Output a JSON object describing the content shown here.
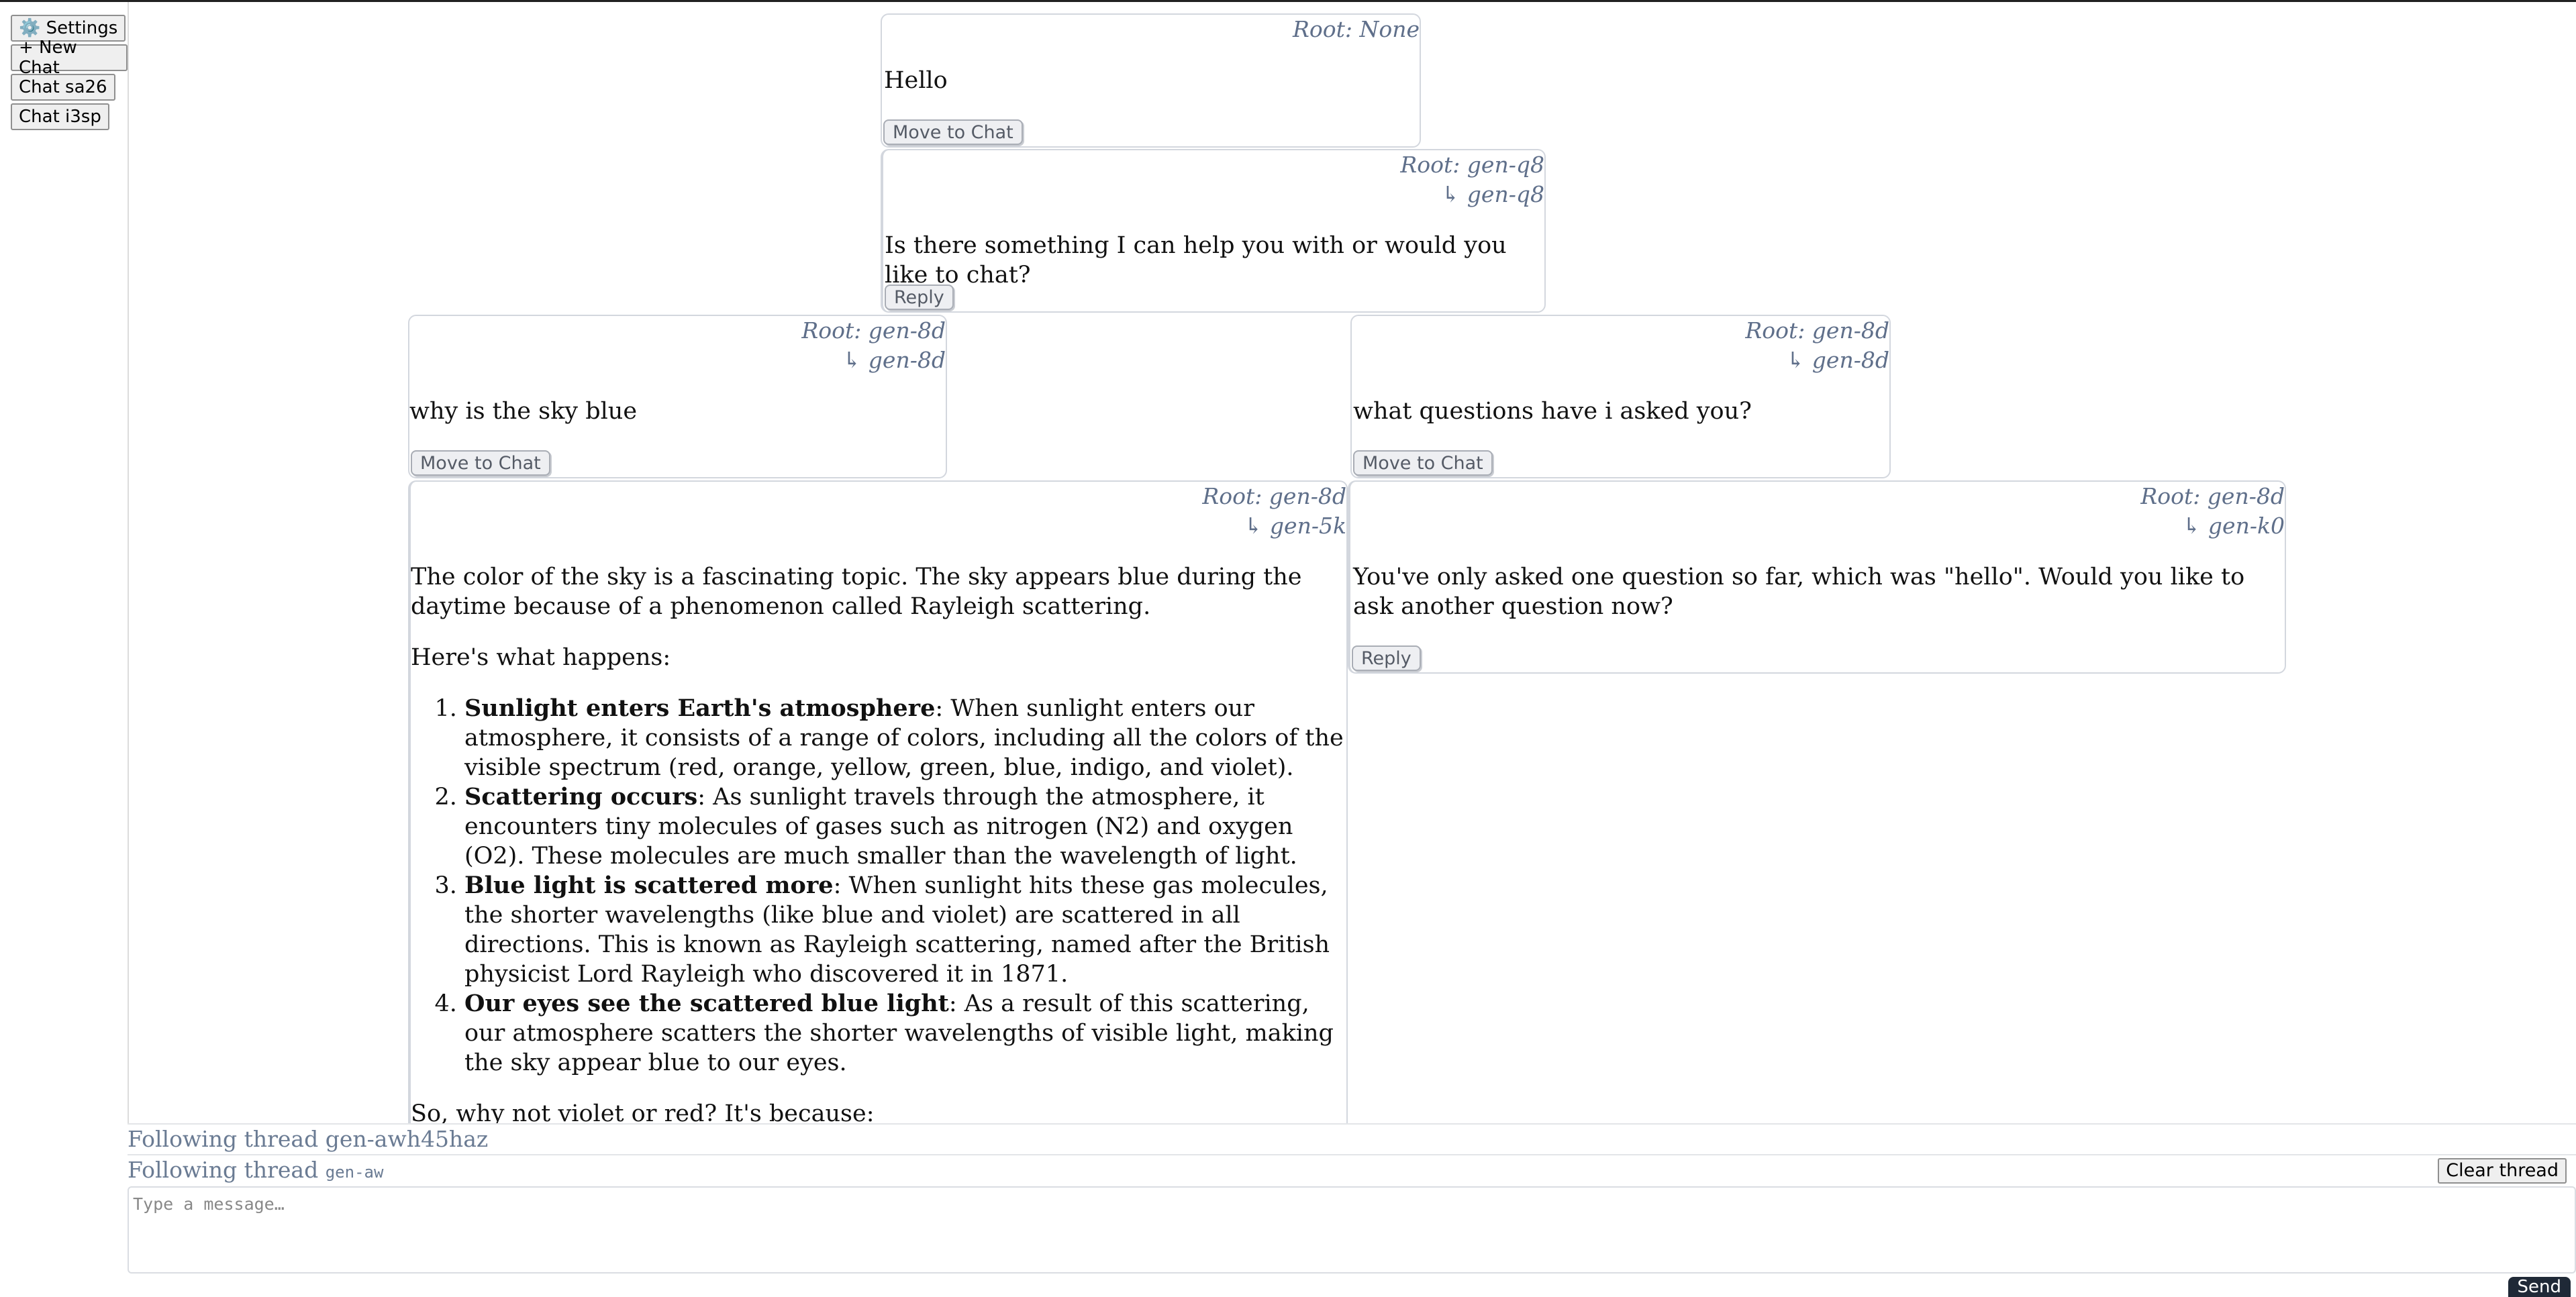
{
  "sidebar": {
    "settings": {
      "icon": "gear-icon",
      "label": "⚙️ Settings"
    },
    "new_chat": "+ New Chat",
    "chats": [
      "Chat sa26",
      "Chat i3sp"
    ]
  },
  "messages": [
    {
      "root": "Root: None",
      "parent": "",
      "text": "Hello",
      "button": "Move to Chat"
    },
    {
      "root": "Root: gen-q8",
      "parent": "↳ gen-q8",
      "text": "Is there something I can help you with or would you like to chat?",
      "button": "Reply"
    },
    {
      "root": "Root: gen-8d",
      "parent": "↳ gen-8d",
      "text": "why is the sky blue",
      "button": "Move to Chat"
    },
    {
      "root": "Root: gen-8d",
      "parent": "↳ gen-8d",
      "text": "what questions have i asked you?",
      "button": "Move to Chat"
    },
    {
      "root": "Root: gen-8d",
      "parent": "↳ gen-5k",
      "intro": "The color of the sky is a fascinating topic. The sky appears blue during the daytime because of a phenomenon called Rayleigh scattering.",
      "lead": "Here's what happens:",
      "items": [
        {
          "bold": "Sunlight enters Earth's atmosphere",
          "rest": ": When sunlight enters our atmosphere, it consists of a range of colors, including all the colors of the visible spectrum (red, orange, yellow, green, blue, indigo, and violet)."
        },
        {
          "bold": "Scattering occurs",
          "rest": ": As sunlight travels through the atmosphere, it encounters tiny molecules of gases such as nitrogen (N2) and oxygen (O2). These molecules are much smaller than the wavelength of light."
        },
        {
          "bold": "Blue light is scattered more",
          "rest": ": When sunlight hits these gas molecules, the shorter wavelengths (like blue and violet) are scattered in all directions. This is known as Rayleigh scattering, named after the British physicist Lord Rayleigh who discovered it in 1871."
        },
        {
          "bold": "Our eyes see the scattered blue light",
          "rest": ": As a result of this scattering, our atmosphere scatters the shorter wavelengths of visible light, making the sky appear blue to our eyes."
        }
      ],
      "outro": "So, why not violet or red? It's because:"
    },
    {
      "root": "Root: gen-8d",
      "parent": "↳ gen-k0",
      "text": "You've only asked one question so far, which was \"hello\". Would you like to ask another question now?",
      "button": "Reply"
    }
  ],
  "footer": {
    "following_1": "Following thread gen-awh45haz",
    "following_2_prefix": "Following thread",
    "following_2_id": "gen-aw",
    "clear_thread": "Clear thread",
    "input_placeholder": "Type a message…",
    "send": "Send"
  }
}
